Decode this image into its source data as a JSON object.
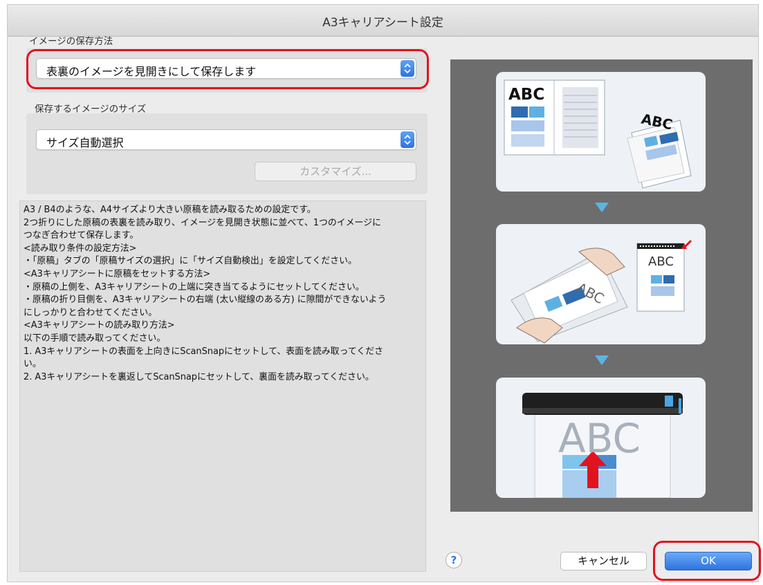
{
  "window": {
    "title": "A3キャリアシート設定"
  },
  "save_method": {
    "label": "イメージの保存方法",
    "selected": "表裏のイメージを見開きにして保存します"
  },
  "image_size": {
    "label": "保存するイメージのサイズ",
    "selected": "サイズ自動選択",
    "customize_label": "カスタマイズ..."
  },
  "description": {
    "lines": [
      "A3 / B4のような、A4サイズより大きい原稿を読み取るための設定です。",
      "2つ折りにした原稿の表裏を読み取り、イメージを見開き状態に並べて、1つのイメージに",
      "つなぎ合わせて保存します。",
      "",
      "<読み取り条件の設定方法>",
      "・「原稿」タブの「原稿サイズの選択」に「サイズ自動検出」を設定してください。",
      "",
      "<A3キャリアシートに原稿をセットする方法>",
      "・原稿の上側を、A3キャリアシートの上端に突き当てるようにセットしてください。",
      "・原稿の折り目側を、A3キャリアシートの右端 (太い縦線のある方) に隙間ができないよう",
      "にしっかりと合わせてください。",
      "",
      "<A3キャリアシートの読み取り方法>",
      "以下の手順で読み取ってください。",
      "1. A3キャリアシートの表面を上向きにScanSnapにセットして、表面を読み取ってくださ",
      "い。",
      "2. A3キャリアシートを裏返してScanSnapにセットして、裏面を読み取ってください。"
    ]
  },
  "illustration": {
    "step1": {
      "left_text": "ABC",
      "right_text": "ABC"
    },
    "step2": {
      "sheet_text": "ABC",
      "card_text": "ABC"
    },
    "step3": {
      "scan_text": "ABC"
    }
  },
  "footer": {
    "help_label": "?",
    "cancel_label": "キャンセル",
    "ok_label": "OK"
  },
  "colors": {
    "highlight": "#e1131f",
    "accent_blue": "#2f74e0",
    "panel_gray": "#6d6d6d"
  }
}
